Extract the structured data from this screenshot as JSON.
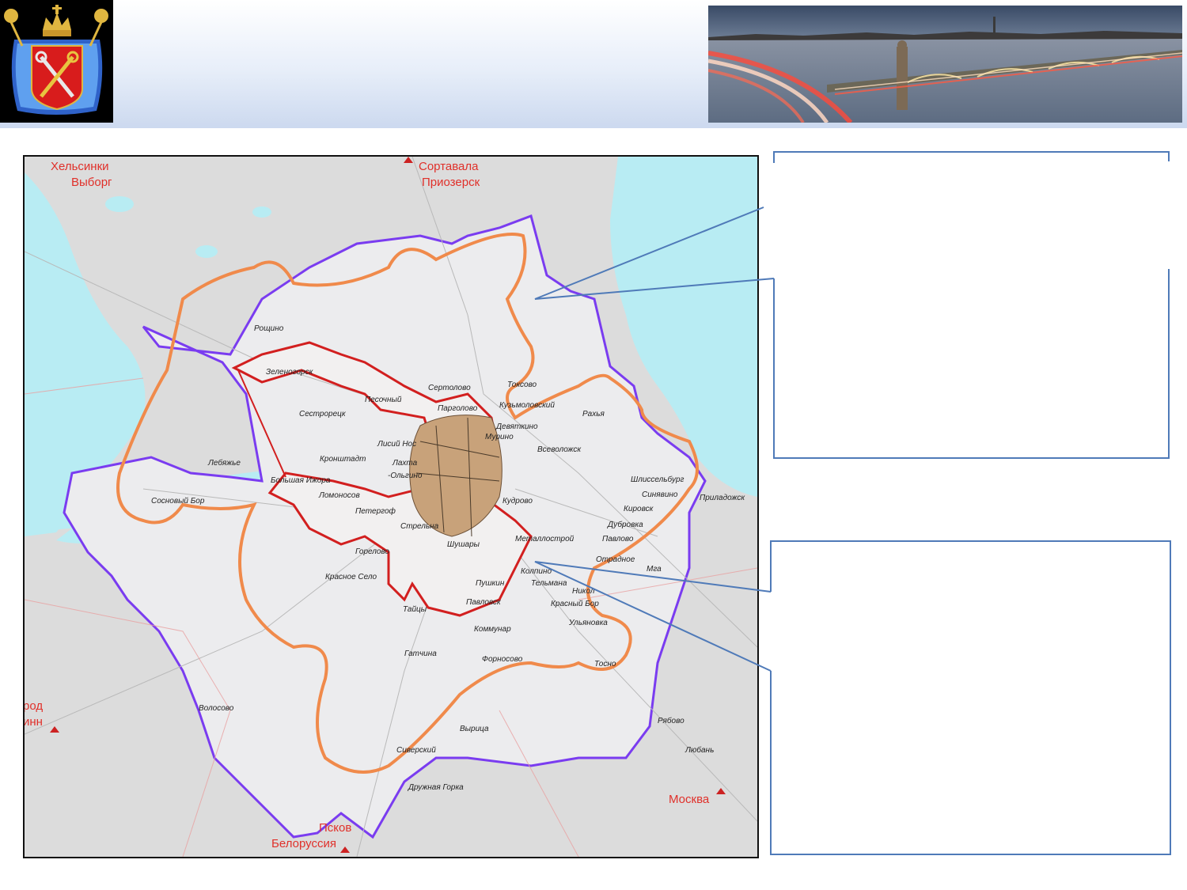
{
  "header": {
    "emblem_icon": "saint-petersburg-coat-of-arms-icon",
    "photo_icon": "trinity-bridge-night-photo"
  },
  "map": {
    "directions": {
      "helsinki": "Хельсинки",
      "vyborg": "Выборг",
      "sortavala": "Сортавала",
      "priozersk": "Приозерск",
      "novgorod_partial": "род",
      "tallinn_partial": "инн",
      "moscow": "Москва",
      "pskov": "Псков",
      "belorussia": "Белоруссия"
    },
    "places": {
      "roshchino": "Рощино",
      "zelenogorsk": "Зеленогорск",
      "sestroretsk": "Сестрорецк",
      "pesochny": "Песочный",
      "sertolovo": "Сертолово",
      "toksovo": "Токсово",
      "pargolovo": "Парголово",
      "kuzmolovsky": "Кузьмоловский",
      "devyatkino": "Девяткино",
      "murino": "Мурино",
      "rakhya": "Рахья",
      "lisiy_nos": "Лисий Нос",
      "lakhta": "Лахта",
      "olgino": "-Ольгино",
      "kronshtadt": "Кронштадт",
      "vsevolozhsk": "Всеволожск",
      "shlisselburg": "Шлиссельбург",
      "sinyavino": "Синявино",
      "priladozhsky": "Приладожск",
      "lebyazhye": "Лебяжье",
      "bolshaya_izhora": "Большая Ижора",
      "sosnovy_bor": "Сосновый Бор",
      "lomonosov": "Ломоносов",
      "peterhof": "Петергоф",
      "kudrovo": "Кудрово",
      "kirovsk": "Кировск",
      "dubrovka": "Дубровка",
      "strelna": "Стрельна",
      "metallostroy": "Металлострой",
      "pavlovo": "Павлово",
      "gorelovo": "Горелово",
      "shushary": "Шушары",
      "otradnoe": "Отрадное",
      "mga": "Мга",
      "krasnoe_selo": "Красное Село",
      "kolpino": "Колпино",
      "pushkin": "Пушкин",
      "telmana": "Тельмана",
      "nikolskoe": "Никол",
      "taitsy": "Тайцы",
      "pavlovsk": "Павловск",
      "krasny_bor": "Красный Бор",
      "ulyanovka": "Ульяновка",
      "kommunar": "Коммунар",
      "gatchina": "Гатчина",
      "fornosovo": "Форносово",
      "tosno": "Тосно",
      "volosovo": "Волосово",
      "ryabovo": "Рябово",
      "vyritsa": "Вырица",
      "siversky": "Сиверский",
      "lyuban": "Любань",
      "druzhnaya_gorka": "Дружная Горка"
    },
    "colors": {
      "water": "#b8ecf3",
      "land_outer": "#dcdcdc",
      "land_region": "#ececee",
      "city_core": "#c8a27a",
      "boundary_purple": "#7a3cf0",
      "boundary_orange": "#f08a4b",
      "boundary_red": "#d21f1f",
      "direction_label": "#e0302a",
      "callout_border": "#4f7ab8"
    }
  }
}
